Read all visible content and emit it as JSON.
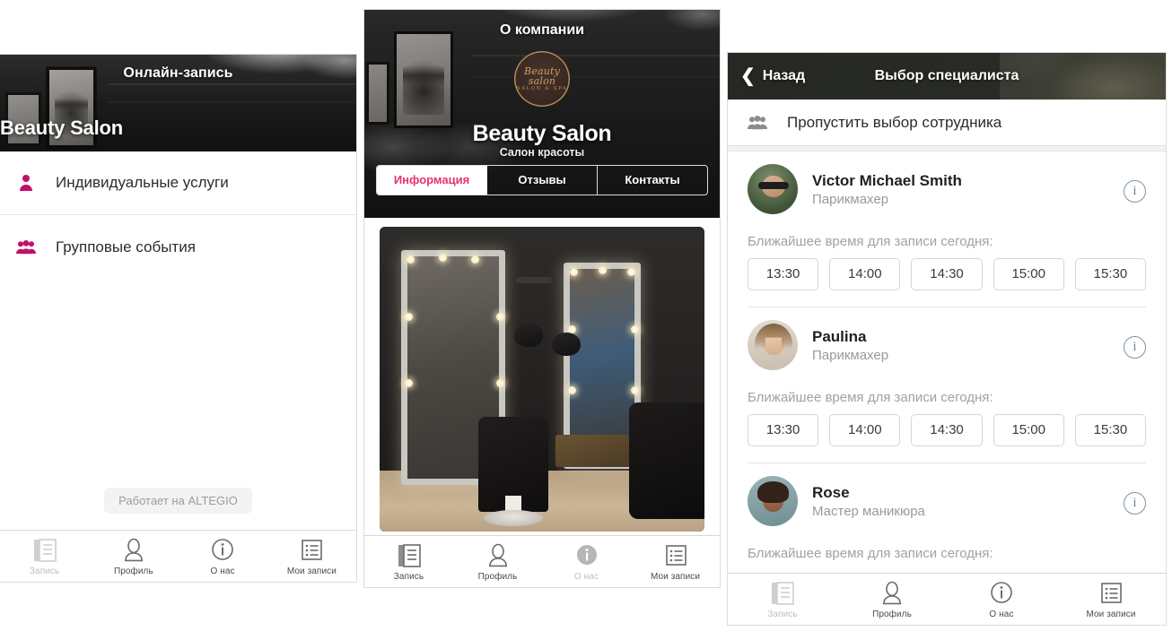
{
  "panel1": {
    "hero": {
      "title": "Онлайн-запись",
      "brand": "Beauty Salon"
    },
    "menu": [
      {
        "icon": "single-person-icon",
        "label": "Индивидуальные услуги"
      },
      {
        "icon": "group-people-icon",
        "label": "Групповые события"
      }
    ],
    "powered_by": "Работает на ALTEGIO",
    "accent_color": "#c0106a",
    "tabbar": [
      {
        "icon": "document-icon",
        "label": "Запись",
        "active": false,
        "dim": true
      },
      {
        "icon": "profile-icon",
        "label": "Профиль",
        "active": false,
        "dim": false
      },
      {
        "icon": "info-circle-icon",
        "label": "О нас",
        "active": false,
        "dim": false
      },
      {
        "icon": "list-icon",
        "label": "Мои записи",
        "active": false,
        "dim": false
      }
    ]
  },
  "panel2": {
    "hero": {
      "title": "О компании",
      "logo_text": "Beauty salon",
      "logo_sub": "SALON & SPA",
      "brand": "Beauty Salon",
      "subtitle": "Салон красоты"
    },
    "tabs": [
      {
        "label": "Информация",
        "active": true
      },
      {
        "label": "Отзывы",
        "active": false
      },
      {
        "label": "Контакты",
        "active": false
      }
    ],
    "active_tab_color": "#e8316d",
    "gallery_image": "barbershop-interior-photo",
    "tabbar": [
      {
        "icon": "document-icon",
        "label": "Запись",
        "active": false,
        "dim": false
      },
      {
        "icon": "profile-icon",
        "label": "Профиль",
        "active": false,
        "dim": false
      },
      {
        "icon": "info-circle-icon",
        "label": "О нас",
        "active": true,
        "dim": true
      },
      {
        "icon": "list-icon",
        "label": "Мои записи",
        "active": false,
        "dim": false
      }
    ]
  },
  "panel3": {
    "header": {
      "back_label": "Назад",
      "title": "Выбор специалиста"
    },
    "skip": {
      "icon": "group-people-icon",
      "label": "Пропустить выбор сотрудника"
    },
    "slots_label": "Ближайшее время для записи сегодня:",
    "specialists": [
      {
        "name": "Victor Michael Smith",
        "role": "Парикмахер",
        "avatar": "man-sunglasses-photo",
        "slots": [
          "13:30",
          "14:00",
          "14:30",
          "15:00",
          "15:30"
        ]
      },
      {
        "name": "Paulina",
        "role": "Парикмахер",
        "avatar": "blonde-woman-photo",
        "slots": [
          "13:30",
          "14:00",
          "14:30",
          "15:00",
          "15:30"
        ]
      },
      {
        "name": "Rose",
        "role": "Мастер маникюра",
        "avatar": "curly-hair-woman-photo",
        "slots": []
      }
    ],
    "info_icon_color": "#6d8496",
    "tabbar": [
      {
        "icon": "document-icon",
        "label": "Запись",
        "active": false,
        "dim": true
      },
      {
        "icon": "profile-icon",
        "label": "Профиль",
        "active": false,
        "dim": false
      },
      {
        "icon": "info-circle-icon",
        "label": "О нас",
        "active": false,
        "dim": false
      },
      {
        "icon": "list-icon",
        "label": "Мои записи",
        "active": false,
        "dim": false
      }
    ]
  }
}
